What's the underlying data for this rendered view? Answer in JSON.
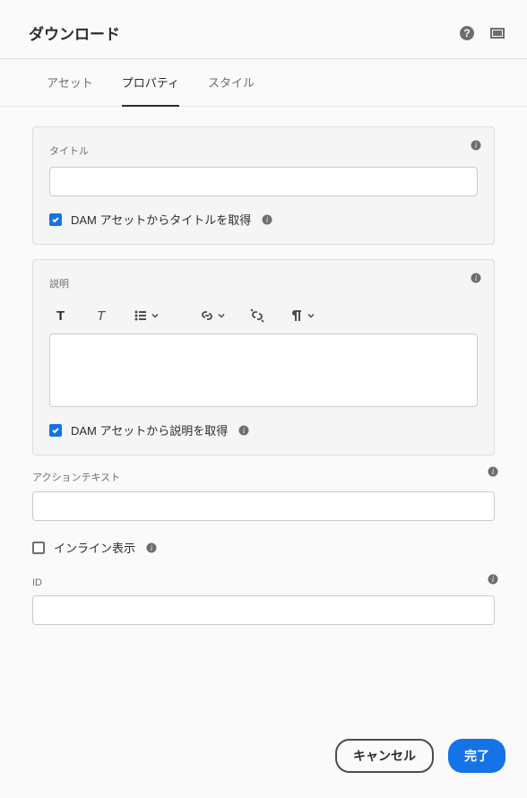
{
  "header": {
    "title": "ダウンロード"
  },
  "tabs": {
    "asset": "アセット",
    "properties": "プロパティ",
    "styles": "スタイル"
  },
  "titlePanel": {
    "label": "タイトル",
    "checkboxLabel": "DAM アセットからタイトルを取得"
  },
  "descPanel": {
    "label": "説明",
    "checkboxLabel": "DAM アセットから説明を取得"
  },
  "actionText": {
    "label": "アクションテキスト"
  },
  "inline": {
    "label": "インライン表示"
  },
  "idField": {
    "label": "ID"
  },
  "footer": {
    "cancel": "キャンセル",
    "done": "完了"
  }
}
